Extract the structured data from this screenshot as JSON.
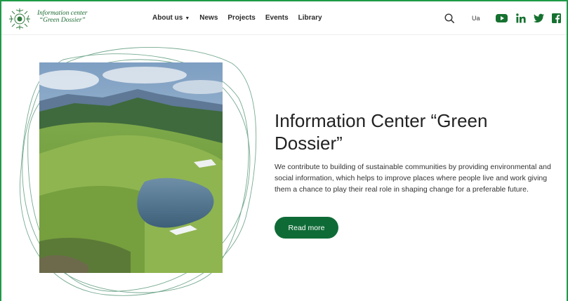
{
  "brand": {
    "line1": "Information center",
    "line2": "“Green Dossier”"
  },
  "nav": {
    "items": [
      {
        "label": "About us",
        "has_dropdown": true
      },
      {
        "label": "News"
      },
      {
        "label": "Projects"
      },
      {
        "label": "Events"
      },
      {
        "label": "Library"
      }
    ],
    "lang_label": "Ua"
  },
  "social": [
    "youtube-icon",
    "linkedin-icon",
    "twitter-icon",
    "facebook-icon"
  ],
  "hero": {
    "title": "Information Center “Green Dossier”",
    "description": "We contribute to building of sustainable communities by providing environmental and social information, which helps to improve places where people live and work giving them a chance to play their real role in shaping change for a preferable future.",
    "cta_label": "Read more"
  },
  "colors": {
    "brand_green": "#0f6b36",
    "frame_green": "#1f9a48",
    "social_green": "#15712f"
  }
}
